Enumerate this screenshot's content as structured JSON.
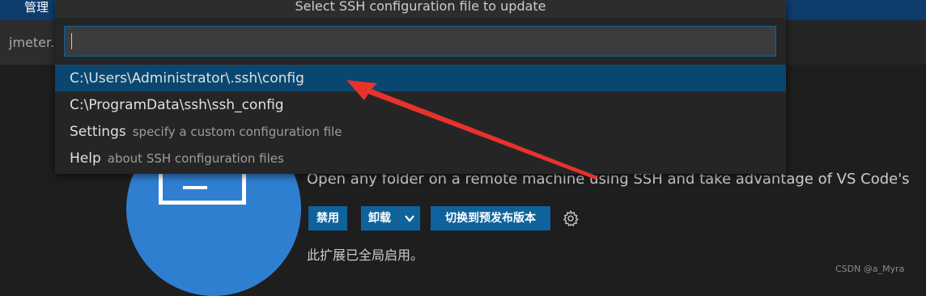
{
  "topbar": {
    "menu_label": "管理"
  },
  "tabbar": {
    "tab_label": "jmeter."
  },
  "quickpick": {
    "title": "Select SSH configuration file to update",
    "input_value": "",
    "items": [
      {
        "label": "C:\\Users\\Administrator\\.ssh\\config",
        "description": ""
      },
      {
        "label": "C:\\ProgramData\\ssh\\ssh_config",
        "description": ""
      },
      {
        "label": "Settings",
        "description": "specify a custom configuration file"
      },
      {
        "label": "Help",
        "description": "about SSH configuration files"
      }
    ]
  },
  "extension": {
    "description": "Open any folder on a remote machine using SSH and take advantage of VS Code's",
    "disable_label": "禁用",
    "uninstall_label": "卸载",
    "prerelease_label": "切换到预发布版本",
    "status_text": "此扩展已全局启用。"
  },
  "watermark": "CSDN @a_Myra",
  "colors": {
    "accent": "#0e639c",
    "selection": "#094771",
    "annotation": "#e8322c"
  },
  "icons": {
    "extension_icon": "remote-ssh-terminal-icon",
    "gear": "gear-icon",
    "dropdown": "chevron-down-icon"
  }
}
